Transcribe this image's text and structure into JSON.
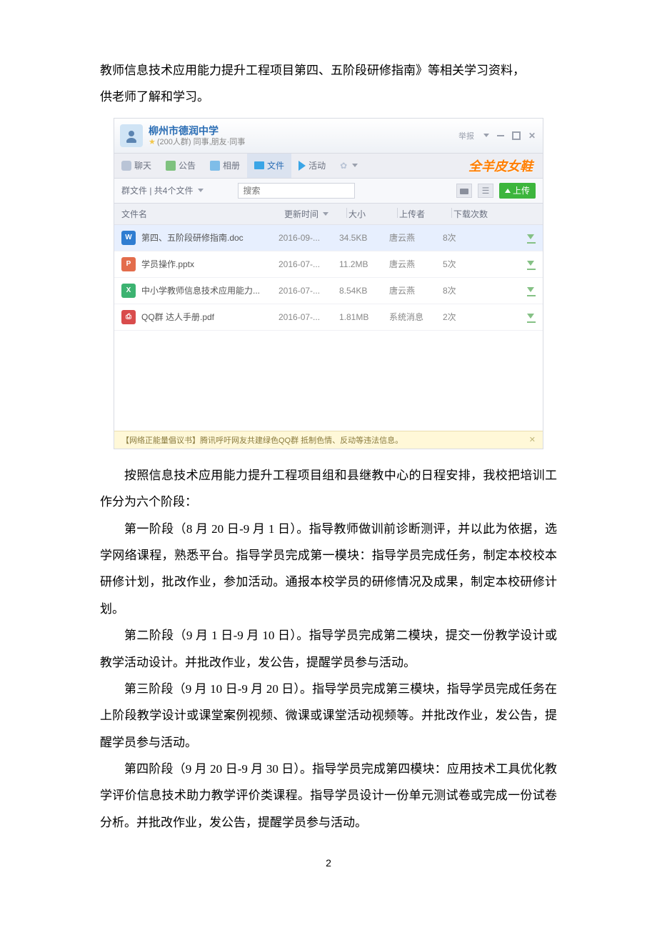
{
  "doc": {
    "intro_line1": "教师信息技术应用能力提升工程项目第四、五阶段研修指南》等相关学习资料，",
    "intro_line2": "供老师了解和学习。",
    "p1": "按照信息技术应用能力提升工程项目组和县继教中心的日程安排，我校把培训工作分为六个阶段：",
    "p2": "第一阶段（8 月 20 日-9 月 1 日）。指导教师做训前诊断测评，并以此为依据，选学网络课程，熟悉平台。指导学员完成第一模块：指导学员完成任务，制定本校校本研修计划，批改作业，参加活动。通报本校学员的研修情况及成果，制定本校研修计划。",
    "p3": "第二阶段（9 月 1 日-9 月 10 日）。指导学员完成第二模块，提交一份教学设计或教学活动设计。并批改作业，发公告，提醒学员参与活动。",
    "p4": "第三阶段（9 月 10 日-9 月 20 日）。指导学员完成第三模块，指导学员完成任务在上阶段教学设计或课堂案例视频、微课或课堂活动视频等。并批改作业，发公告，提醒学员参与活动。",
    "p5": "第四阶段（9 月 20 日-9 月 30 日）。指导学员完成第四模块：应用技术工具优化教学评价信息技术助力教学评价类课程。指导学员设计一份单元测试卷或完成一份试卷分析。并批改作业，发公告，提醒学员参与活动。",
    "page_num": "2"
  },
  "qq": {
    "group_name": "柳州市德润中学",
    "group_sub": "(200人群) 同事,朋友·同事",
    "report_label": "举报",
    "ad_text": "全羊皮女鞋",
    "tabs": {
      "chat": "聊天",
      "notice": "公告",
      "album": "相册",
      "file": "文件",
      "activity": "活动"
    },
    "toolbar": {
      "breadcrumb": "群文件  |  共4个文件",
      "search_placeholder": "搜索",
      "upload_label": "上传"
    },
    "columns": {
      "name": "文件名",
      "time": "更新时间",
      "size": "大小",
      "uploader": "上传者",
      "downloads": "下载次数"
    },
    "files": [
      {
        "icon": "W",
        "cls": "f-doc",
        "name": "第四、五阶段研修指南.doc",
        "time": "2016-09-...",
        "size": "34.5KB",
        "uploader": "唐云燕",
        "dl": "8次",
        "sel": true
      },
      {
        "icon": "P",
        "cls": "f-ppt",
        "name": "学员操作.pptx",
        "time": "2016-07-...",
        "size": "11.2MB",
        "uploader": "唐云燕",
        "dl": "5次",
        "sel": false
      },
      {
        "icon": "X",
        "cls": "f-xls",
        "name": "中小学教师信息技术应用能力...",
        "time": "2016-07-...",
        "size": "8.54KB",
        "uploader": "唐云燕",
        "dl": "8次",
        "sel": false
      },
      {
        "icon": "",
        "cls": "f-pdf",
        "name": "QQ群 达人手册.pdf",
        "time": "2016-07-...",
        "size": "1.81MB",
        "uploader": "系统消息",
        "dl": "2次",
        "sel": false
      }
    ],
    "footer_text": "【网络正能量倡议书】腾讯呼吁网友共建绿色QQ群 抵制色情、反动等违法信息。"
  }
}
